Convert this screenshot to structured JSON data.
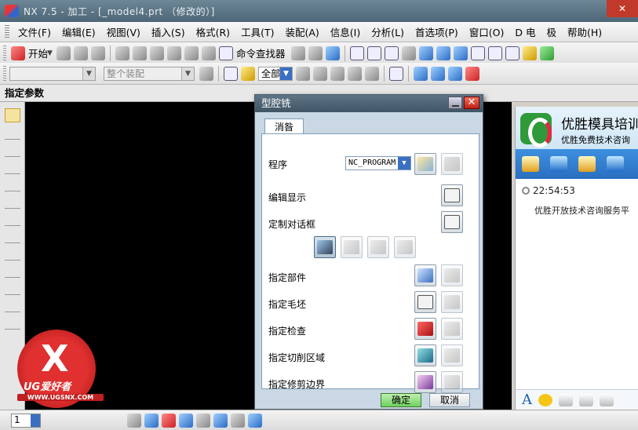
{
  "window": {
    "title": "NX 7.5 - 加工 - [_model4.prt （修改的）]",
    "close_glyph": "✕"
  },
  "menubar": {
    "items": [
      "文件(F)",
      "编辑(E)",
      "视图(V)",
      "插入(S)",
      "格式(R)",
      "工具(T)",
      "装配(A)",
      "信息(I)",
      "分析(L)",
      "首选项(P)",
      "窗口(O)",
      "D 电",
      "极",
      "帮助(H)"
    ]
  },
  "toolbar1": {
    "start_label": "开始",
    "command_finder_label": "命令查找器"
  },
  "toolbar2": {
    "filter_value": "",
    "scope_value": "整个装配",
    "snap_value": "全部"
  },
  "param_bar": {
    "label": "指定参数"
  },
  "dialog": {
    "title": "型腔铣",
    "tab_label": "消昝",
    "program_label": "程序",
    "program_value": "NC_PROGRAM",
    "edit_display_label": "编辑显示",
    "custom_dialog_label": "定制对话框",
    "rows": [
      {
        "label": "指定部件",
        "icon": "part-icon"
      },
      {
        "label": "指定毛坯",
        "icon": "blank-icon"
      },
      {
        "label": "指定检查",
        "icon": "check-icon"
      },
      {
        "label": "指定切削区域",
        "icon": "cut-area-icon"
      },
      {
        "label": "指定修剪边界",
        "icon": "trim-boundary-icon"
      }
    ],
    "ok_label": "确定",
    "cancel_label": "取消"
  },
  "chat": {
    "name": "优胜模具培训",
    "subtitle": "优胜免费技术咨询",
    "time": "22:54:53",
    "message": "优胜开放技术咨询服务平"
  },
  "watermark": {
    "brand": "UG爱好者",
    "url": "WWW.UGSNX.COM"
  },
  "bottom_bar": {
    "page_value": "1"
  },
  "colors": {
    "viewport": "#000000",
    "dialog_bg": "#c9d8e4",
    "ok_green": "#6fd060",
    "accent_blue": "#3a6fc2"
  }
}
